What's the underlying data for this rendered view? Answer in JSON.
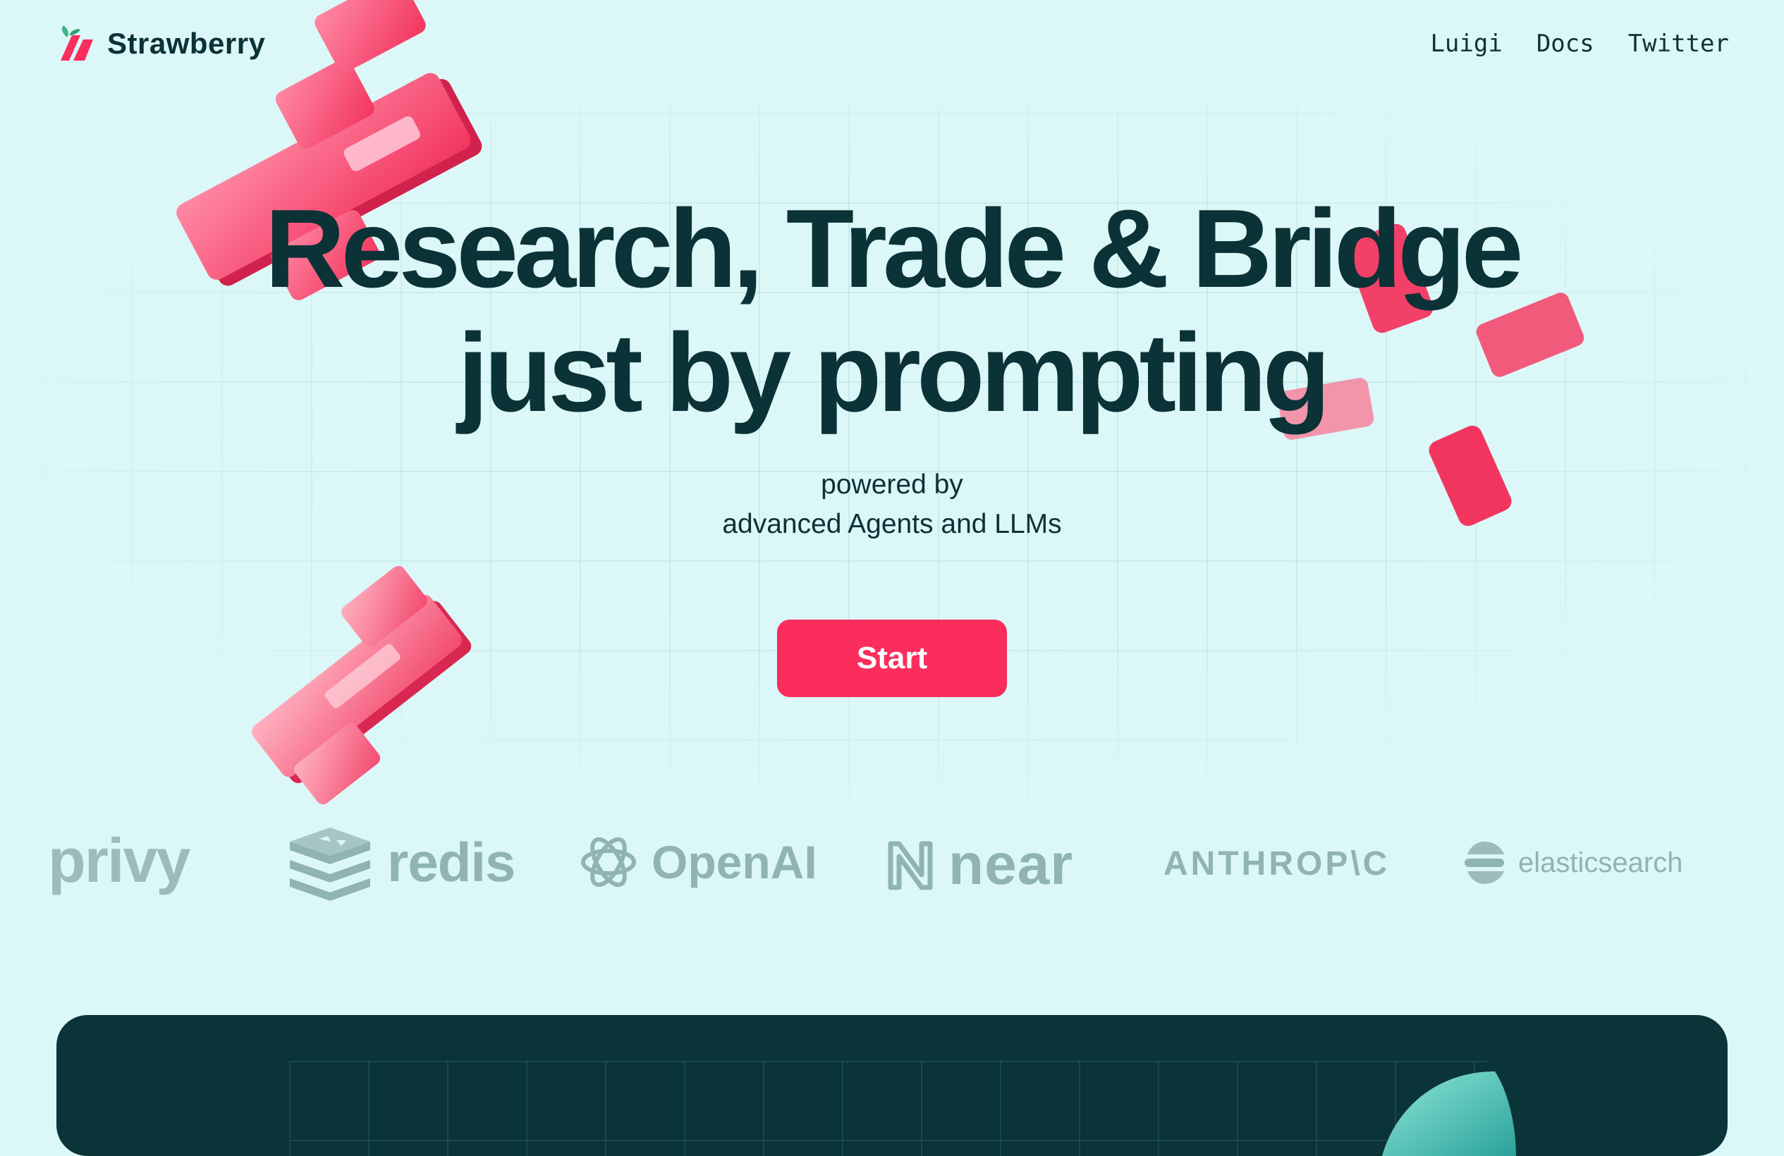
{
  "brand": {
    "name": "Strawberry",
    "logo_icon": "strawberry-logo-icon",
    "accent": "#fa2d5d"
  },
  "nav": {
    "items": [
      "Luigi",
      "Docs",
      "Twitter"
    ]
  },
  "hero": {
    "headline_line1": "Research, Trade & Bridge",
    "headline_line2": "just by prompting",
    "subtitle_line1": "powered by",
    "subtitle_line2": "advanced Agents and LLMs",
    "cta_label": "Start"
  },
  "partners": [
    {
      "name": "privy",
      "icon": "privy-logo"
    },
    {
      "name": "redis",
      "icon": "redis-stack-icon"
    },
    {
      "name": "OpenAI",
      "icon": "openai-knot-icon"
    },
    {
      "name": "near",
      "icon": "near-n-icon"
    },
    {
      "name": "ANTHROP\\C",
      "icon": "anthropic-wordmark"
    },
    {
      "name": "elasticsearch",
      "icon": "elasticsearch-icon"
    }
  ],
  "colors": {
    "background": "#dcf7f7",
    "text": "#0b3236",
    "cta": "#fa2d5d",
    "panel": "#0b3438",
    "logo_muted": "#8fb4b2"
  }
}
